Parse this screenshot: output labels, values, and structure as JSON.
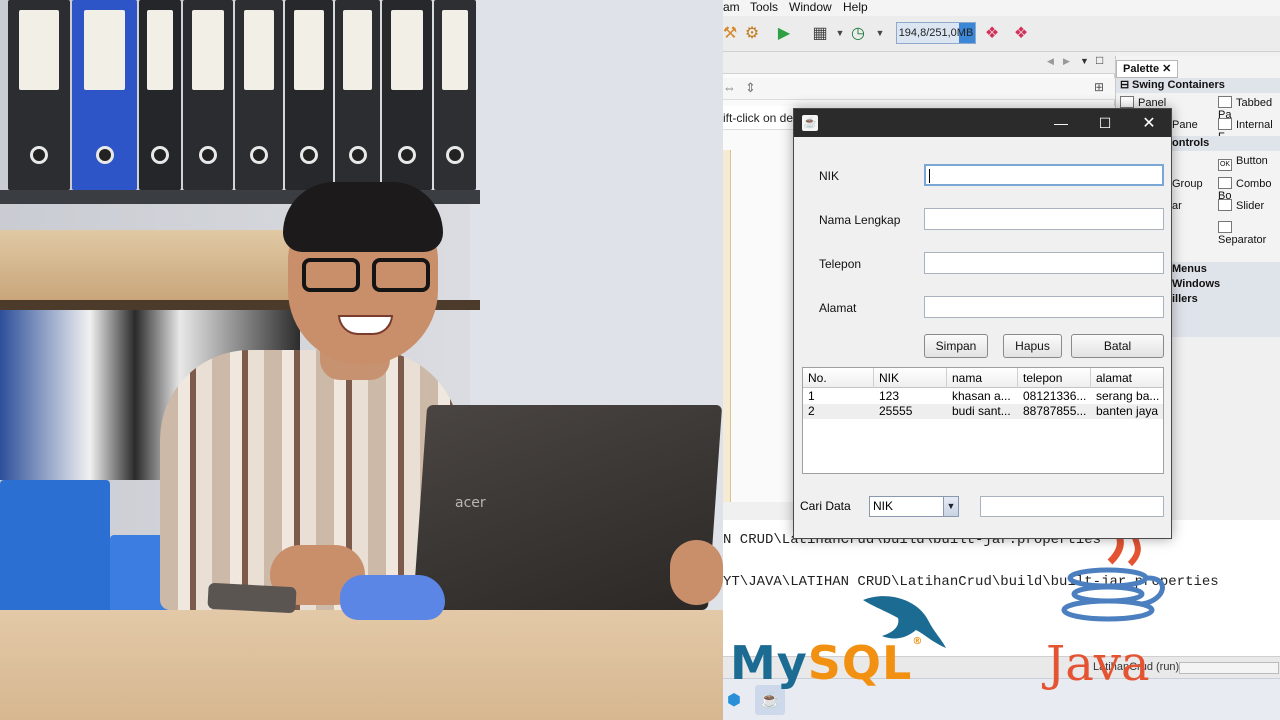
{
  "ide": {
    "menu": [
      "am",
      "Tools",
      "Window",
      "Help"
    ],
    "memory": "194,8/251,0MB",
    "hint": "ift-click on desi",
    "output_lines": [
      "N CRUD\\LatihanCrud\\build\\built-jar.properties",
      "YT\\JAVA\\LATIHAN CRUD\\LatihanCrud\\build\\built-jar.properties"
    ],
    "status": "LatihanCrud (run)"
  },
  "palette": {
    "tab": "Palette",
    "categories": [
      "Swing Containers",
      "ontrols",
      "Menus",
      "Windows",
      "illers"
    ],
    "items": {
      "panel": "Panel",
      "tabbed_pane": "Tabbed Pa",
      "pane": "Pane",
      "internal_frame": "Internal F",
      "button": "Button",
      "group": "Group",
      "combo_box": "Combo Bo",
      "bar": "ar",
      "slider": "Slider",
      "separator": "Separator"
    }
  },
  "dialog": {
    "fields": [
      {
        "label": "NIK",
        "value": ""
      },
      {
        "label": "Nama Lengkap",
        "value": ""
      },
      {
        "label": "Telepon",
        "value": ""
      },
      {
        "label": "Alamat",
        "value": ""
      }
    ],
    "buttons": {
      "save": "Simpan",
      "delete": "Hapus",
      "cancel": "Batal"
    },
    "table": {
      "headers": [
        "No.",
        "NIK",
        "nama",
        "telepon",
        "alamat"
      ],
      "rows": [
        [
          "1",
          "123",
          "khasan a...",
          "08121336...",
          "serang ba..."
        ],
        [
          "2",
          "25555",
          "budi sant...",
          "88787855...",
          "banten jaya"
        ]
      ]
    },
    "search": {
      "label": "Cari Data",
      "selected": "NIK",
      "value": ""
    }
  },
  "logos": {
    "mysql_my": "My",
    "mysql_sql": "SQL",
    "java": "Java"
  },
  "icons": {
    "minimize": "minimize-icon",
    "maximize": "maximize-icon",
    "close": "close-icon",
    "dropdown": "chevron-down-icon"
  },
  "colors": {
    "titlebar": "#2b2b2b",
    "mysql_blue": "#1c6b93",
    "mysql_orange": "#f29111",
    "java_red": "#e45432"
  }
}
